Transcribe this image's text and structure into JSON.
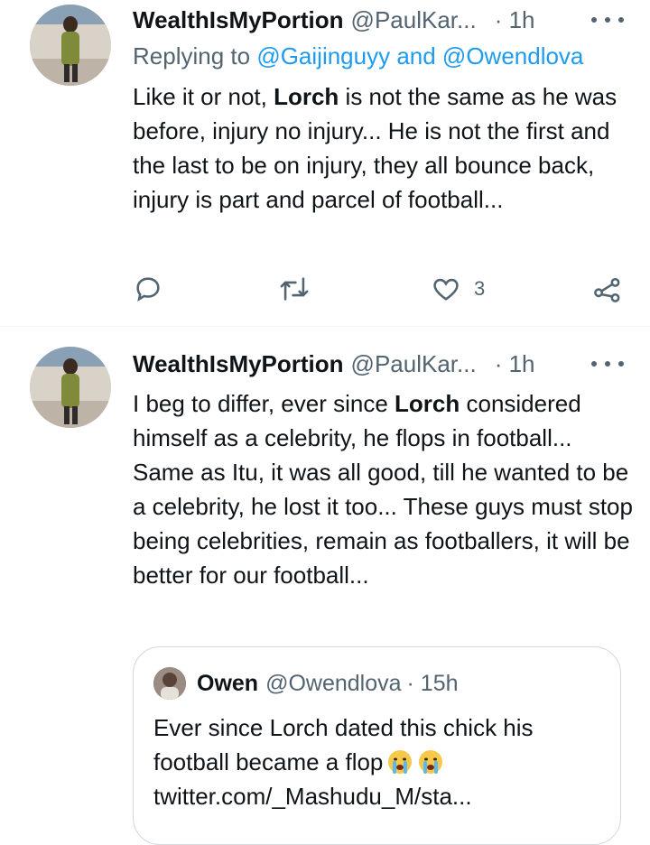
{
  "tweets": [
    {
      "name": "WealthIsMyPortion",
      "handle": "@PaulKar...",
      "time": "· 1h",
      "replying_prefix": "Replying to ",
      "replying_to": "@Gaijinguyy and @Owendlova",
      "body_1": "Like it or not, ",
      "body_bold": "Lorch",
      "body_2": " is not the same as he was before, injury no injury... He is not the first and the last to be on injury, they all bounce back, injury is part and parcel of football...",
      "like_count": "3"
    },
    {
      "name": "WealthIsMyPortion",
      "handle": "@PaulKar...",
      "time": "· 1h",
      "body_1": "I beg to differ, ever since ",
      "body_bold": "Lorch",
      "body_2": " considered himself as a celebrity, he flops in football... Same as Itu, it was all good, till he wanted to be a celebrity, he lost it too... These guys must stop being celebrities, remain as footballers, it will be better for our football...",
      "quoted": {
        "name": "Owen",
        "handle": "@Owendlova",
        "time": "· 15h",
        "text": "Ever since Lorch dated this chick his football became a flop",
        "link": "twitter.com/_Mashudu_M/sta..."
      }
    }
  ],
  "icons": [
    "reply-icon",
    "retweet-icon",
    "like-icon",
    "share-icon",
    "more-icon",
    "crying-emoji"
  ],
  "colors": {
    "link": "#1d9bf0",
    "secondary_text": "#536471",
    "primary_text": "#0f1419"
  }
}
